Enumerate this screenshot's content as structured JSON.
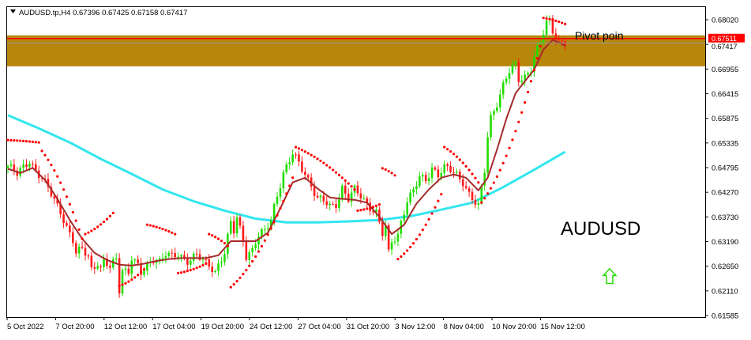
{
  "header": {
    "symbol_line": "AUDUSD.tp,H4  0.67396 0.67425 0.67158 0.67417"
  },
  "annotations": {
    "pivot_label": "Pivot poin",
    "symbol_watermark": "AUDUSD"
  },
  "price_tags": {
    "pivot": "0.67511",
    "current": "0.67417"
  },
  "colors": {
    "background": "#ffffff",
    "bull_candle": "#22dd00",
    "bear_candle": "#ff1a1a",
    "fast_ma": "#a52a2a",
    "slow_ma": "#33e6ee",
    "sar_dots": "#ff0000",
    "zone": "#b8860b",
    "pivot_line": "#ff0000",
    "arrow": "#22dd00"
  },
  "chart_data": {
    "type": "candlestick",
    "title": "AUDUSD.tp,H4",
    "ylim": [
      0.61585,
      0.6818
    ],
    "y_ticks": [
      "0.68020",
      "0.67485",
      "0.66955",
      "0.66415",
      "0.65875",
      "0.65335",
      "0.64795",
      "0.64270",
      "0.63730",
      "0.63190",
      "0.62650",
      "0.62110",
      "0.61585"
    ],
    "x_ticks": [
      "5 Oct 2022",
      "7 Oct 20:00",
      "12 Oct 12:00",
      "17 Oct 04:00",
      "19 Oct 20:00",
      "24 Oct 12:00",
      "27 Oct 04:00",
      "31 Oct 20:00",
      "3 Nov 12:00",
      "8 Nov 04:00",
      "10 Nov 20:00",
      "15 Nov 12:00"
    ],
    "pivot_level": 0.67511,
    "current_price": 0.67417,
    "zone": [
      0.6692,
      0.6758
    ],
    "close_path": [
      [
        0,
        0.648
      ],
      [
        3,
        0.6462
      ],
      [
        5,
        0.6478
      ],
      [
        7,
        0.6493
      ],
      [
        9,
        0.647
      ],
      [
        11,
        0.6452
      ],
      [
        13,
        0.6432
      ],
      [
        15,
        0.6408
      ],
      [
        17,
        0.6385
      ],
      [
        19,
        0.635
      ],
      [
        21,
        0.632
      ],
      [
        22,
        0.6292
      ],
      [
        24,
        0.6303
      ],
      [
        26,
        0.629
      ],
      [
        27,
        0.6262
      ],
      [
        29,
        0.6275
      ],
      [
        30,
        0.626
      ],
      [
        31,
        0.6276
      ],
      [
        33,
        0.6263
      ],
      [
        35,
        0.6283
      ],
      [
        36,
        0.6218
      ],
      [
        37,
        0.6262
      ],
      [
        39,
        0.6255
      ],
      [
        40,
        0.6285
      ],
      [
        42,
        0.6264
      ],
      [
        43,
        0.625
      ],
      [
        45,
        0.6268
      ],
      [
        47,
        0.6284
      ],
      [
        49,
        0.6278
      ],
      [
        51,
        0.6292
      ],
      [
        53,
        0.6285
      ],
      [
        55,
        0.6292
      ],
      [
        57,
        0.6283
      ],
      [
        58,
        0.628
      ],
      [
        59,
        0.6282
      ],
      [
        61,
        0.629
      ],
      [
        63,
        0.6276
      ],
      [
        65,
        0.627
      ],
      [
        67,
        0.6255
      ],
      [
        68,
        0.6272
      ],
      [
        70,
        0.6295
      ],
      [
        72,
        0.6358
      ],
      [
        73,
        0.634
      ],
      [
        74,
        0.6368
      ],
      [
        76,
        0.6325
      ],
      [
        77,
        0.629
      ],
      [
        79,
        0.6302
      ],
      [
        80,
        0.6318
      ],
      [
        81,
        0.633
      ],
      [
        83,
        0.634
      ],
      [
        85,
        0.6365
      ],
      [
        86,
        0.6395
      ],
      [
        87,
        0.642
      ],
      [
        89,
        0.6465
      ],
      [
        91,
        0.649
      ],
      [
        92,
        0.6505
      ],
      [
        94,
        0.6485
      ],
      [
        96,
        0.6465
      ],
      [
        98,
        0.644
      ],
      [
        100,
        0.641
      ],
      [
        102,
        0.6405
      ],
      [
        104,
        0.6392
      ],
      [
        106,
        0.64
      ],
      [
        108,
        0.6435
      ],
      [
        110,
        0.641
      ],
      [
        112,
        0.6428
      ],
      [
        114,
        0.6415
      ],
      [
        116,
        0.64
      ],
      [
        118,
        0.6388
      ],
      [
        119,
        0.6382
      ],
      [
        121,
        0.6335
      ],
      [
        122,
        0.635
      ],
      [
        123,
        0.6292
      ],
      [
        124,
        0.6318
      ],
      [
        126,
        0.6335
      ],
      [
        127,
        0.6362
      ],
      [
        129,
        0.6408
      ],
      [
        131,
        0.6425
      ],
      [
        133,
        0.6455
      ],
      [
        135,
        0.645
      ],
      [
        137,
        0.6478
      ],
      [
        139,
        0.6462
      ],
      [
        141,
        0.6475
      ],
      [
        143,
        0.647
      ],
      [
        145,
        0.6462
      ],
      [
        147,
        0.6448
      ],
      [
        149,
        0.642
      ],
      [
        151,
        0.64
      ],
      [
        152,
        0.6392
      ],
      [
        154,
        0.647
      ],
      [
        155,
        0.6545
      ],
      [
        156,
        0.6585
      ],
      [
        158,
        0.6615
      ],
      [
        160,
        0.665
      ],
      [
        162,
        0.668
      ],
      [
        164,
        0.6695
      ],
      [
        165,
        0.6665
      ],
      [
        167,
        0.6672
      ],
      [
        169,
        0.6688
      ],
      [
        170,
        0.6712
      ],
      [
        172,
        0.674
      ],
      [
        174,
        0.6785
      ],
      [
        175,
        0.679
      ],
      [
        176,
        0.677
      ],
      [
        178,
        0.6745
      ],
      [
        180,
        0.6742
      ]
    ],
    "fast_ma_path": [
      [
        0,
        0.6474
      ],
      [
        4,
        0.6465
      ],
      [
        8,
        0.6476
      ],
      [
        12,
        0.645
      ],
      [
        16,
        0.641
      ],
      [
        20,
        0.6365
      ],
      [
        24,
        0.6325
      ],
      [
        28,
        0.6295
      ],
      [
        32,
        0.628
      ],
      [
        36,
        0.627
      ],
      [
        40,
        0.6268
      ],
      [
        44,
        0.6272
      ],
      [
        48,
        0.6278
      ],
      [
        52,
        0.6282
      ],
      [
        56,
        0.6284
      ],
      [
        60,
        0.6284
      ],
      [
        64,
        0.6284
      ],
      [
        68,
        0.629
      ],
      [
        72,
        0.632
      ],
      [
        76,
        0.632
      ],
      [
        80,
        0.632
      ],
      [
        84,
        0.6338
      ],
      [
        88,
        0.639
      ],
      [
        92,
        0.6445
      ],
      [
        96,
        0.6455
      ],
      [
        100,
        0.6432
      ],
      [
        104,
        0.6413
      ],
      [
        108,
        0.641
      ],
      [
        112,
        0.6408
      ],
      [
        116,
        0.6402
      ],
      [
        120,
        0.6372
      ],
      [
        124,
        0.6335
      ],
      [
        128,
        0.6355
      ],
      [
        132,
        0.64
      ],
      [
        136,
        0.643
      ],
      [
        140,
        0.6455
      ],
      [
        144,
        0.6462
      ],
      [
        148,
        0.6455
      ],
      [
        152,
        0.6428
      ],
      [
        155,
        0.6455
      ],
      [
        158,
        0.6515
      ],
      [
        161,
        0.658
      ],
      [
        164,
        0.6635
      ],
      [
        167,
        0.666
      ],
      [
        170,
        0.6685
      ],
      [
        173,
        0.6728
      ],
      [
        176,
        0.6748
      ],
      [
        179,
        0.674
      ],
      [
        180,
        0.6735
      ]
    ],
    "slow_ma_path": [
      [
        0,
        0.6588
      ],
      [
        10,
        0.656
      ],
      [
        20,
        0.653
      ],
      [
        30,
        0.6495
      ],
      [
        40,
        0.6463
      ],
      [
        50,
        0.643
      ],
      [
        60,
        0.6405
      ],
      [
        70,
        0.6385
      ],
      [
        80,
        0.6368
      ],
      [
        90,
        0.636
      ],
      [
        100,
        0.636
      ],
      [
        110,
        0.6362
      ],
      [
        120,
        0.6365
      ],
      [
        130,
        0.6373
      ],
      [
        140,
        0.6387
      ],
      [
        150,
        0.6402
      ],
      [
        160,
        0.6435
      ],
      [
        170,
        0.6472
      ],
      [
        180,
        0.651
      ]
    ],
    "sar_segments": [
      {
        "from": 0,
        "to": 10,
        "start": 0.6535,
        "end": 0.653,
        "above": false
      },
      {
        "from": 11,
        "to": 24,
        "start": 0.6512,
        "end": 0.6325,
        "above": true
      },
      {
        "from": 25,
        "to": 34,
        "start": 0.6335,
        "end": 0.638,
        "above": true
      },
      {
        "from": 36,
        "to": 44,
        "start": 0.6225,
        "end": 0.626,
        "above": false
      },
      {
        "from": 45,
        "to": 54,
        "start": 0.6355,
        "end": 0.6335,
        "above": true
      },
      {
        "from": 55,
        "to": 64,
        "start": 0.6252,
        "end": 0.6272,
        "above": false
      },
      {
        "from": 65,
        "to": 71,
        "start": 0.6335,
        "end": 0.631,
        "above": true
      },
      {
        "from": 72,
        "to": 92,
        "start": 0.6222,
        "end": 0.6455,
        "above": false
      },
      {
        "from": 93,
        "to": 112,
        "start": 0.652,
        "end": 0.643,
        "above": true
      },
      {
        "from": 113,
        "to": 120,
        "start": 0.6385,
        "end": 0.6398,
        "above": false
      },
      {
        "from": 121,
        "to": 125,
        "start": 0.6475,
        "end": 0.646,
        "above": true
      },
      {
        "from": 126,
        "to": 140,
        "start": 0.6282,
        "end": 0.642,
        "above": false
      },
      {
        "from": 141,
        "to": 152,
        "start": 0.652,
        "end": 0.6445,
        "above": true
      },
      {
        "from": 153,
        "to": 172,
        "start": 0.6402,
        "end": 0.6735,
        "above": false
      },
      {
        "from": 173,
        "to": 180,
        "start": 0.6795,
        "end": 0.6782,
        "above": true
      }
    ],
    "grid": false,
    "legend": "none"
  }
}
